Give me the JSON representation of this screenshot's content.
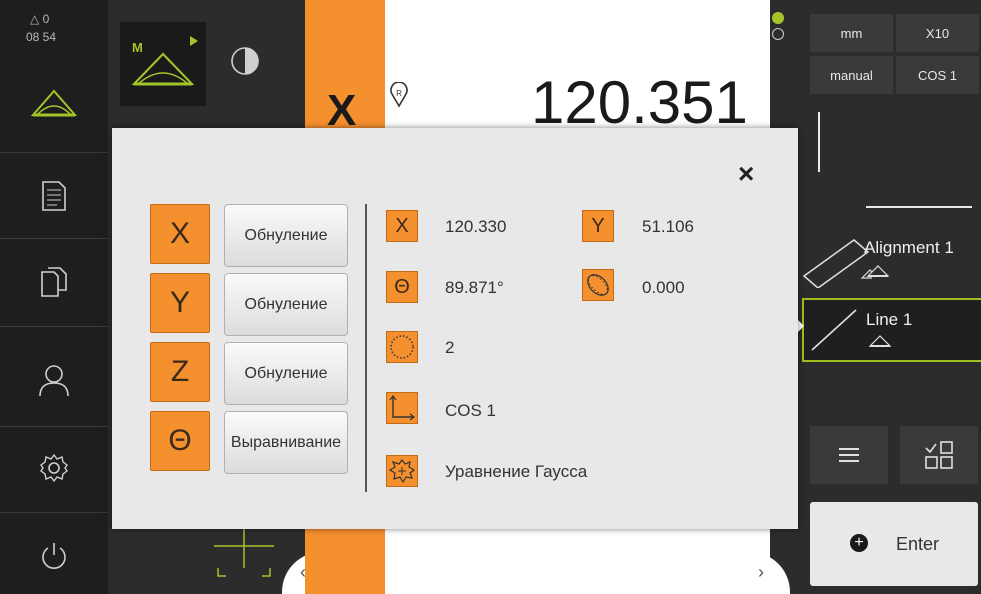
{
  "status": {
    "messages_count": "0",
    "time": "08 54"
  },
  "nav": {
    "items": [
      {
        "name": "measure",
        "icon": "measure-icon"
      },
      {
        "name": "protocol",
        "icon": "document-icon"
      },
      {
        "name": "file-management",
        "icon": "files-icon"
      },
      {
        "name": "user-login",
        "icon": "user-icon"
      },
      {
        "name": "settings",
        "icon": "gear-icon"
      },
      {
        "name": "switch-off",
        "icon": "power-icon"
      }
    ]
  },
  "background": {
    "axis_label": "X",
    "position_value": "120.351",
    "reference_marker": "R"
  },
  "inspector": {
    "unit": "mm",
    "magnification": "X10",
    "mode": "manual",
    "coordinate_system": "COS 1",
    "features": [
      {
        "label": "Alignment 1"
      },
      {
        "label": "Line 1"
      }
    ],
    "enter_label": "Enter"
  },
  "dialog": {
    "close_label": "×",
    "axes": [
      {
        "axis": "X",
        "action": "Обнуление"
      },
      {
        "axis": "Y",
        "action": "Обнуление"
      },
      {
        "axis": "Z",
        "action": "Обнуление"
      },
      {
        "axis": "Θ",
        "action": "Выравнивание"
      }
    ],
    "info": {
      "x_label": "X",
      "x_value": "120.330",
      "y_label": "Y",
      "y_value": "51.106",
      "theta_label": "Θ",
      "theta_value": "89.871°",
      "form_value": "0.000",
      "points_value": "2",
      "cos_value": "COS 1",
      "fit_value": "Уравнение Гаусса"
    }
  },
  "colors": {
    "accent": "#f5902e",
    "selected": "#9ec01e",
    "dark": "#2c2c2c"
  }
}
